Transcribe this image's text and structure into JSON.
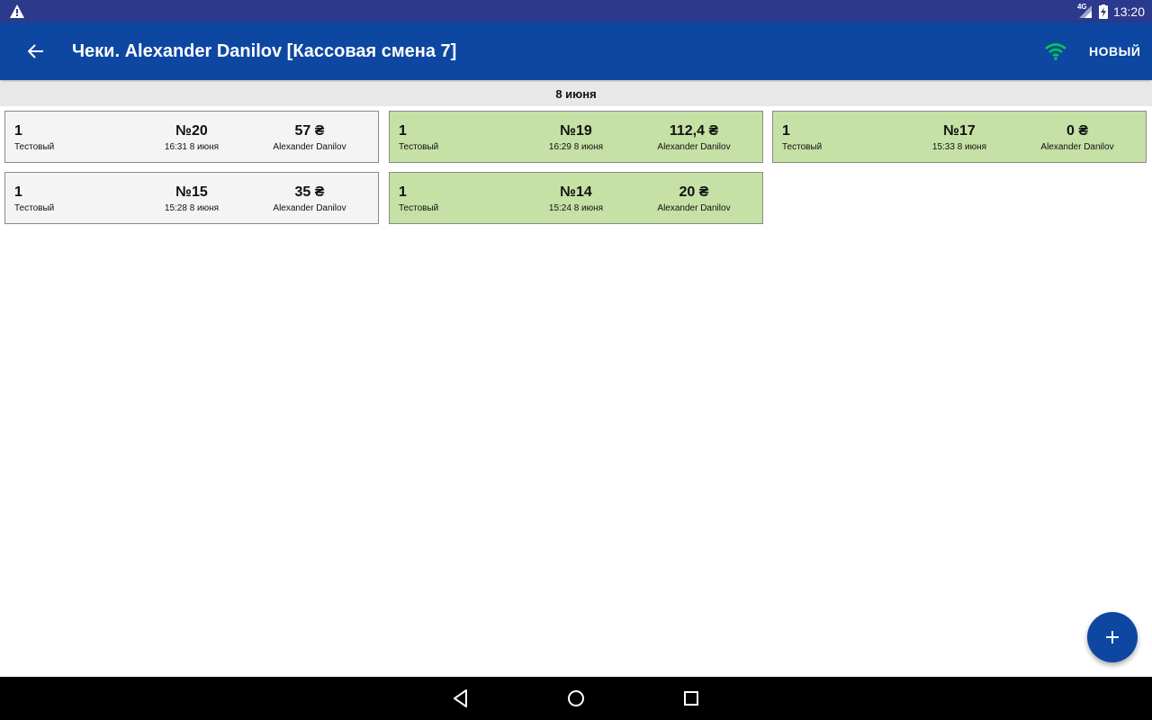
{
  "status_bar": {
    "warning_icon": "warning-icon",
    "network_label": "4G",
    "time": "13:20",
    "bg_color": "#2b3a8c"
  },
  "app_bar": {
    "title": "Чеки. Alexander Danilov [Кассовая смена 7]",
    "new_label": "НОВЫЙ",
    "back_icon": "arrow-back-icon",
    "wifi_icon": "wifi-icon",
    "wifi_color": "#00c853",
    "bg_color": "#0d47a1"
  },
  "date_header": "8 июня",
  "receipts": [
    {
      "qty": "1",
      "shop": "Тестовый",
      "number": "№20",
      "time": "16:31 8 июня",
      "sum": "57 ₴",
      "cashier": "Alexander Danilov",
      "status_color": "#f4f4f4"
    },
    {
      "qty": "1",
      "shop": "Тестовый",
      "number": "№19",
      "time": "16:29 8 июня",
      "sum": "112,4 ₴",
      "cashier": "Alexander Danilov",
      "status_color": "#c5e1a5"
    },
    {
      "qty": "1",
      "shop": "Тестовый",
      "number": "№17",
      "time": "15:33 8 июня",
      "sum": "0 ₴",
      "cashier": "Alexander Danilov",
      "status_color": "#c5e1a5"
    },
    {
      "qty": "1",
      "shop": "Тестовый",
      "number": "№15",
      "time": "15:28 8 июня",
      "sum": "35 ₴",
      "cashier": "Alexander Danilov",
      "status_color": "#f4f4f4"
    },
    {
      "qty": "1",
      "shop": "Тестовый",
      "number": "№14",
      "time": "15:24 8 июня",
      "sum": "20 ₴",
      "cashier": "Alexander Danilov",
      "status_color": "#c5e1a5"
    }
  ],
  "fab": {
    "icon": "plus-icon",
    "color": "#0d47a1"
  },
  "nav_bar": {
    "back_icon": "nav-back-icon",
    "home_icon": "nav-home-icon",
    "recents_icon": "nav-recents-icon"
  }
}
